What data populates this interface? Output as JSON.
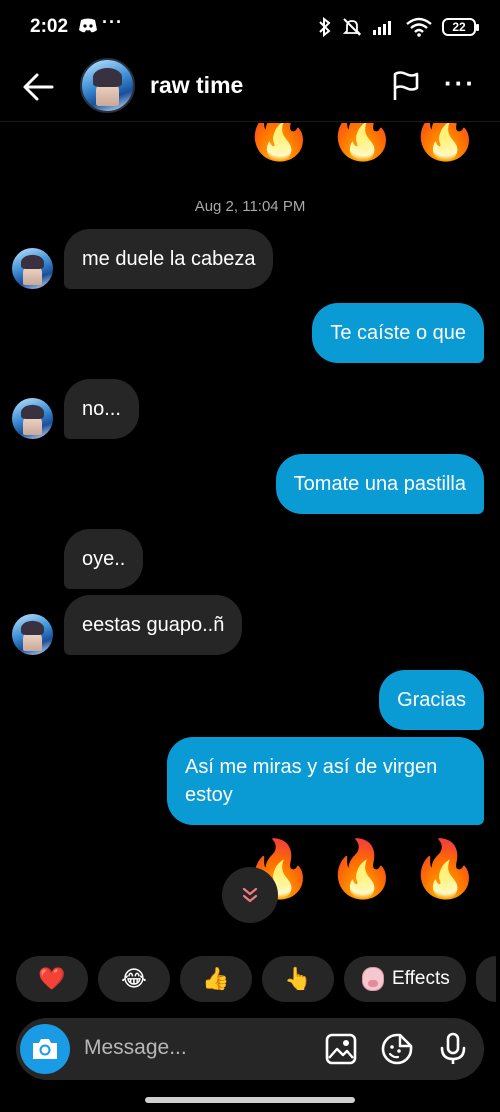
{
  "status": {
    "time": "2:02",
    "battery": "22"
  },
  "header": {
    "contact_name": "raw time"
  },
  "chat": {
    "date_divider": "Aug 2, 11:04 PM",
    "fire_emoji": "🔥",
    "messages": [
      {
        "side": "in",
        "text": "me duele la cabeza"
      },
      {
        "side": "out",
        "text": "Te caíste o que"
      },
      {
        "side": "in",
        "text": "no..."
      },
      {
        "side": "out",
        "text": "Tomate una pastilla"
      },
      {
        "side": "in",
        "text": "oye.."
      },
      {
        "side": "in",
        "text": "eestas guapo..ñ"
      },
      {
        "side": "out",
        "text": "Gracias"
      },
      {
        "side": "out",
        "text_line1": "Así me miras y así de virgen",
        "text_line2": "estoy"
      }
    ]
  },
  "reactions": {
    "heart": "❤️",
    "laugh": "😂",
    "thumbs_up": "👍",
    "pointing": "👆",
    "effects_label": "Effects"
  },
  "composer": {
    "placeholder": "Message..."
  },
  "colors": {
    "background": "#000000",
    "incoming_bubble": "#262626",
    "outgoing_bubble": "#0a9ad4",
    "camera_button": "#1a9be6"
  }
}
